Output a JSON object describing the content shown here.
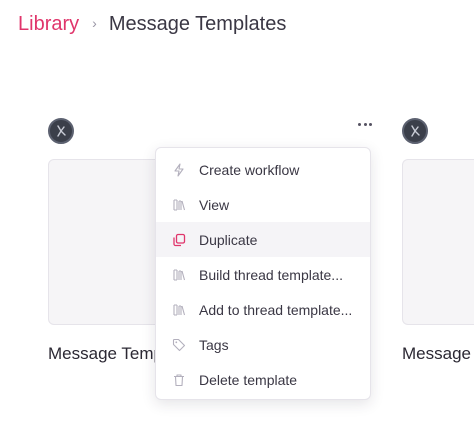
{
  "breadcrumb": {
    "root": "Library",
    "separator": "›",
    "current": "Message Templates"
  },
  "cards": [
    {
      "title": "Message Templates"
    },
    {
      "title": "Message Templates"
    }
  ],
  "menu": {
    "items": [
      {
        "label": "Create workflow",
        "icon": "lightning-icon"
      },
      {
        "label": "View",
        "icon": "books-icon"
      },
      {
        "label": "Duplicate",
        "icon": "copy-icon"
      },
      {
        "label": "Build thread template...",
        "icon": "books-icon"
      },
      {
        "label": "Add to thread template...",
        "icon": "books-icon"
      },
      {
        "label": "Tags",
        "icon": "tag-icon"
      },
      {
        "label": "Delete template",
        "icon": "trash-icon"
      }
    ]
  },
  "colors": {
    "accent": "#e0356b",
    "text": "#3a3744",
    "muted_icon": "#b3b0bd",
    "menu_hover": "#f5f4f7"
  }
}
